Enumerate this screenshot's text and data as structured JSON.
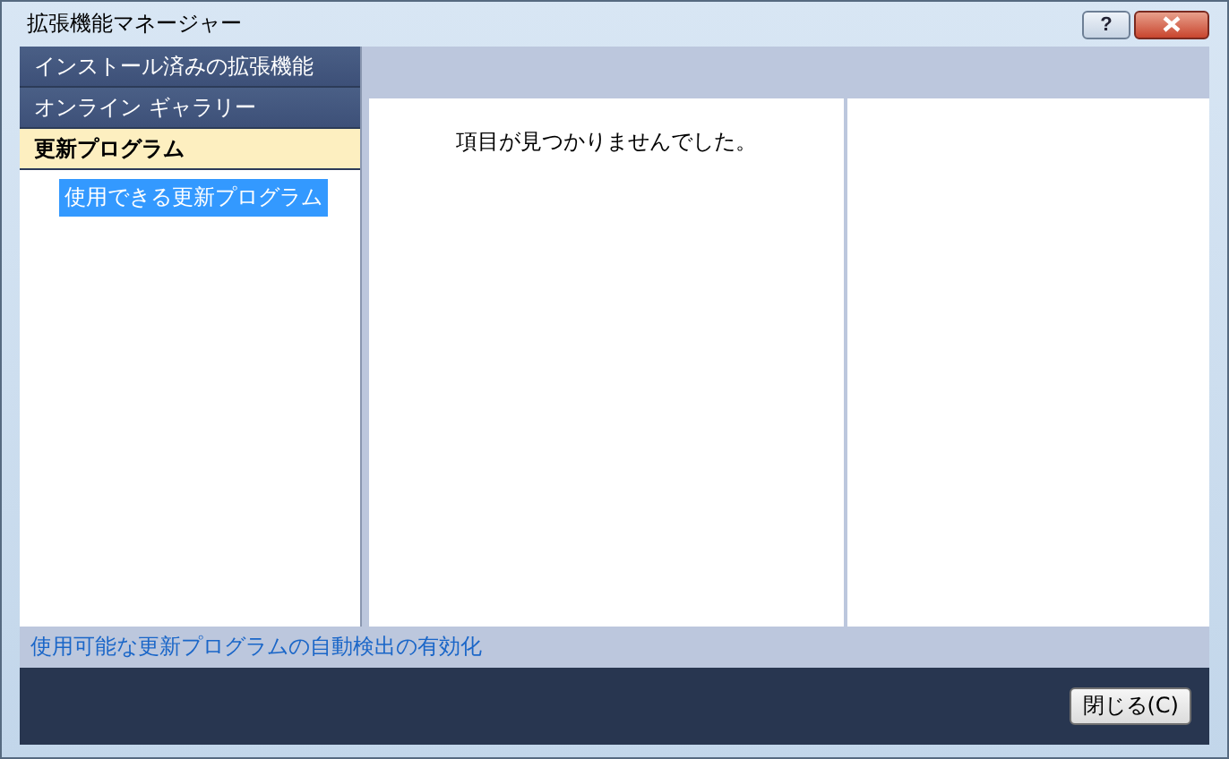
{
  "window": {
    "title": "拡張機能マネージャー",
    "help_button": "?"
  },
  "nav": [
    {
      "label": "インストール済みの拡張機能",
      "selected": false
    },
    {
      "label": "オンライン ギャラリー",
      "selected": false
    },
    {
      "label": "更新プログラム",
      "selected": true,
      "children": [
        {
          "label": "使用できる更新プログラム",
          "selected": true
        }
      ]
    }
  ],
  "list": {
    "empty_message": "項目が見つかりませんでした。"
  },
  "link": "使用可能な更新プログラムの自動検出の有効化",
  "buttons": [
    "閉じる(C)"
  ]
}
